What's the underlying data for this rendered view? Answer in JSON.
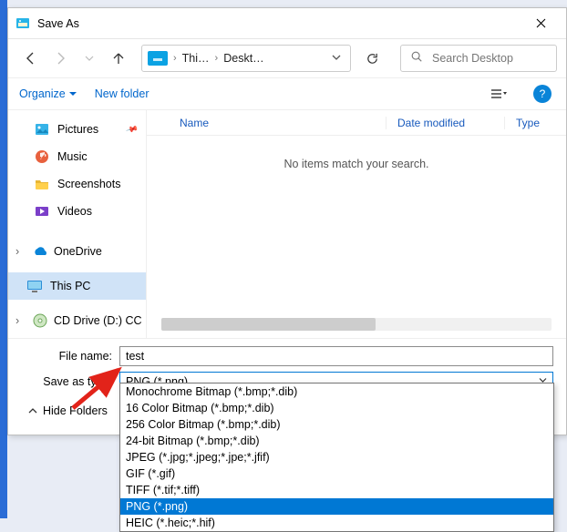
{
  "window": {
    "title": "Save As"
  },
  "address": {
    "crumb1": "Thi…",
    "crumb2": "Deskt…"
  },
  "search": {
    "placeholder": "Search Desktop"
  },
  "cmdbar": {
    "organize": "Organize",
    "newfolder": "New folder"
  },
  "sidebar": {
    "pictures": "Pictures",
    "music": "Music",
    "screenshots": "Screenshots",
    "videos": "Videos",
    "onedrive": "OneDrive",
    "thispc": "This PC",
    "cddrive": "CD Drive (D:) CCC"
  },
  "columns": {
    "name": "Name",
    "date": "Date modified",
    "type": "Type"
  },
  "main": {
    "empty": "No items match your search."
  },
  "footer": {
    "filename_label": "File name:",
    "filename_value": "test",
    "saveas_label": "Save as type:",
    "saveas_value": "PNG (*.png)",
    "hide_folders": "Hide Folders"
  },
  "types": [
    "Monochrome Bitmap (*.bmp;*.dib)",
    "16 Color Bitmap (*.bmp;*.dib)",
    "256 Color Bitmap (*.bmp;*.dib)",
    "24-bit Bitmap (*.bmp;*.dib)",
    "JPEG (*.jpg;*.jpeg;*.jpe;*.jfif)",
    "GIF (*.gif)",
    "TIFF (*.tif;*.tiff)",
    "PNG (*.png)",
    "HEIC (*.heic;*.hif)"
  ],
  "selected_type_index": 7
}
